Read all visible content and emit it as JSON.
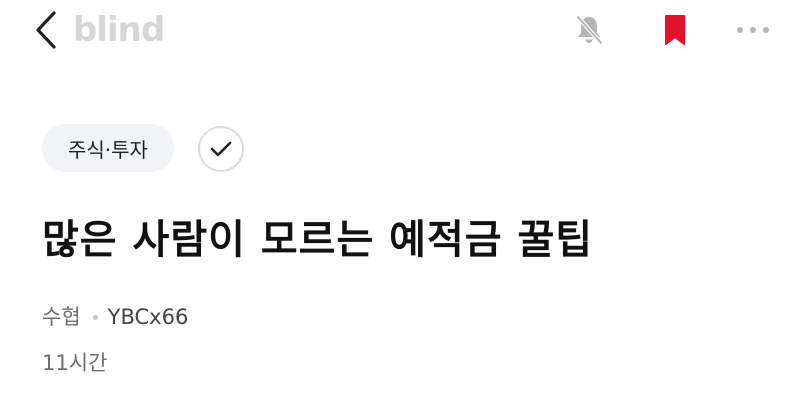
{
  "header": {
    "logo_text": "blind",
    "icons": {
      "back": "chevron-left-icon",
      "notification": "bell-muted-icon",
      "bookmark": "bookmark-icon",
      "more": "more-dots-icon"
    },
    "colors": {
      "logo": "#d6d6d6",
      "bookmark_active": "#e3122a",
      "icon_muted": "#b5b5b5"
    }
  },
  "post": {
    "category": "주식·투자",
    "follow_icon": "check-icon",
    "title": "많은 사람이 모르는 예적금 꿀팁",
    "company": "수협",
    "author": "YBCx66",
    "time_ago": "11시간"
  }
}
